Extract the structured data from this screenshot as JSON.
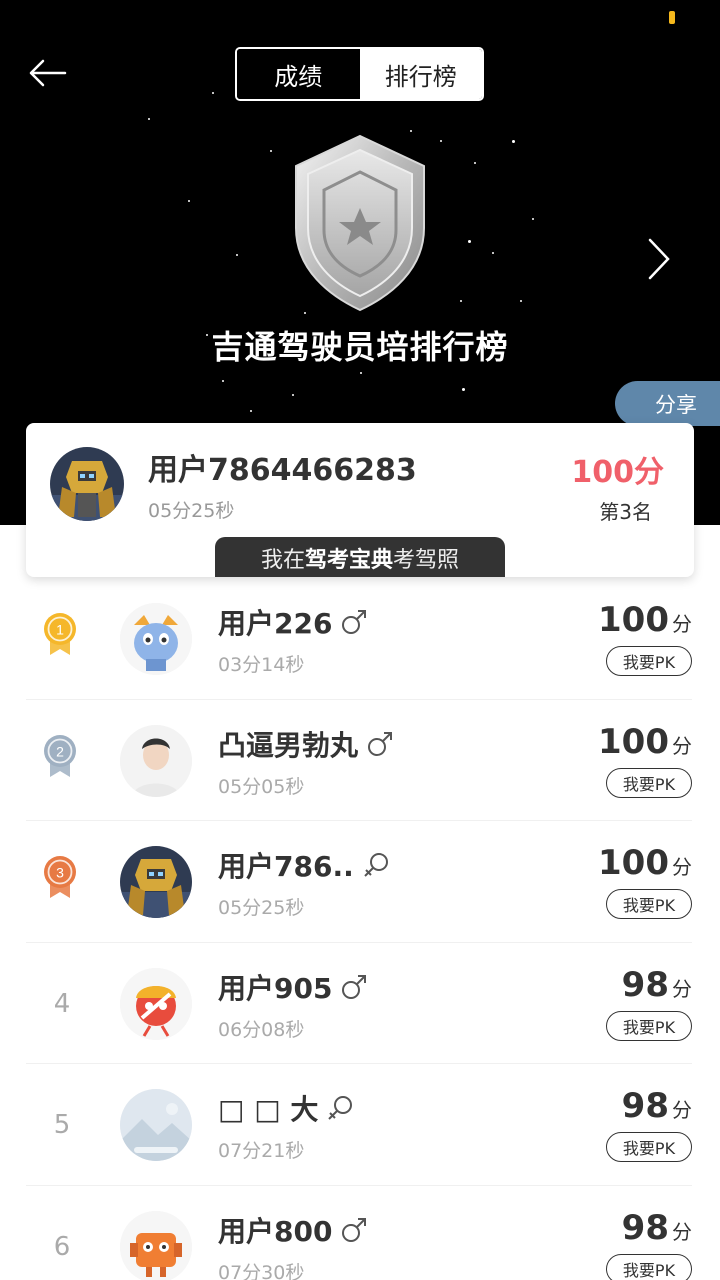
{
  "header": {
    "tabs": [
      {
        "label": "成绩",
        "active": true
      },
      {
        "label": "排行榜",
        "active": false
      }
    ],
    "board_title": "吉通驾驶员培排行榜",
    "share_label": "分享",
    "badge_icon": "silver-shield-star-icon"
  },
  "my_card": {
    "name": "用户7864466283",
    "time": "05分25秒",
    "score": "100分",
    "rank": "第3名",
    "promo_prefix": "我在",
    "promo_bold": "驾考宝典",
    "promo_suffix": "考驾照"
  },
  "colors": {
    "accent_score": "#f0606a",
    "share_bg": "#5f87aa",
    "gold": "#f5b72a",
    "silver": "#9fb0c2",
    "bronze": "#e77a44"
  },
  "ranking": [
    {
      "rank": "1",
      "medal": "gold-medal-icon",
      "name": "用户226",
      "gender": "male",
      "time": "03分14秒",
      "score": "100",
      "unit": "分",
      "pk": "我要PK"
    },
    {
      "rank": "2",
      "medal": "silver-medal-icon",
      "name": "凸逼男勃丸",
      "gender": "male",
      "time": "05分05秒",
      "score": "100",
      "unit": "分",
      "pk": "我要PK"
    },
    {
      "rank": "3",
      "medal": "bronze-medal-icon",
      "name": "用户786..",
      "gender": "female",
      "time": "05分25秒",
      "score": "100",
      "unit": "分",
      "pk": "我要PK"
    },
    {
      "rank": "4",
      "medal": "",
      "name": "用户905",
      "gender": "male",
      "time": "06分08秒",
      "score": "98",
      "unit": "分",
      "pk": "我要PK"
    },
    {
      "rank": "5",
      "medal": "",
      "name": "□ □ 大",
      "gender": "female",
      "time": "07分21秒",
      "score": "98",
      "unit": "分",
      "pk": "我要PK"
    },
    {
      "rank": "6",
      "medal": "",
      "name": "用户800",
      "gender": "male",
      "time": "07分30秒",
      "score": "98",
      "unit": "分",
      "pk": "我要PK"
    }
  ]
}
